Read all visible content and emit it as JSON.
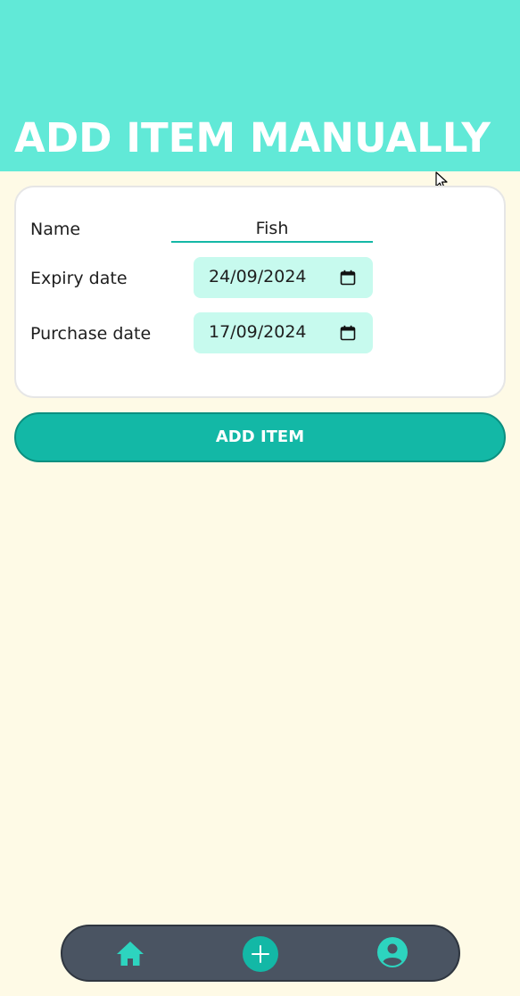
{
  "header": {
    "title": "ADD ITEM MANUALLY"
  },
  "form": {
    "name_label": "Name",
    "name_value": "Fish",
    "expiry_label": "Expiry date",
    "expiry_value": "24/09/2024",
    "purchase_label": "Purchase date",
    "purchase_value": "17/09/2024"
  },
  "actions": {
    "add_label": "ADD ITEM"
  },
  "bottom_nav": {
    "items": [
      {
        "icon": "home-icon"
      },
      {
        "icon": "add-icon"
      },
      {
        "icon": "profile-icon"
      }
    ]
  },
  "colors": {
    "header_bg": "#61e9d7",
    "page_bg": "#fefae6",
    "accent": "#13b8a6",
    "date_field_bg": "#c7faee",
    "nav_bg": "#4a5462"
  }
}
